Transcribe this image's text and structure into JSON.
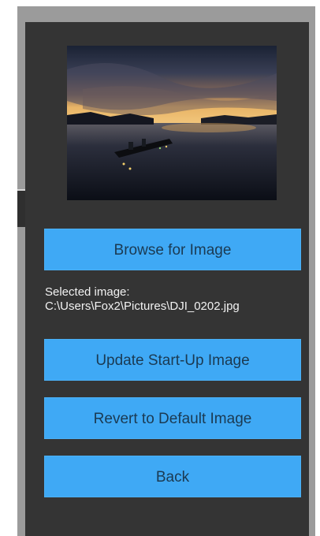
{
  "buttons": {
    "browse": "Browse for Image",
    "update": "Update Start-Up Image",
    "revert": "Revert to Default Image",
    "back": "Back"
  },
  "selected": {
    "label": "Selected image:",
    "path": "C:\\Users\\Fox2\\Pictures\\DJI_0202.jpg"
  },
  "preview": {
    "icon": "startup-image-preview",
    "description_colors": {
      "sky_top": "#1c2436",
      "horizon": "#e9b56a",
      "water": "#10141e"
    }
  },
  "colors": {
    "panel": "#343434",
    "button": "#3fa9f5",
    "button_text": "#1b3a52"
  }
}
